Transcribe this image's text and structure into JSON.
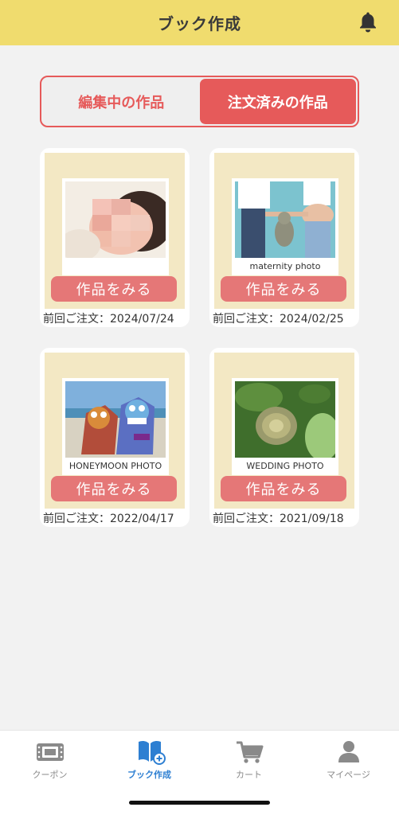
{
  "header": {
    "title": "ブック作成"
  },
  "segment": {
    "tab_editing": "編集中の作品",
    "tab_ordered": "注文済みの作品",
    "active": "ordered"
  },
  "cards": [
    {
      "label": "",
      "button": "作品をみる",
      "date_prefix": "前回ご注文：",
      "date": "2024/07/24",
      "photo": "baby-photo"
    },
    {
      "label": "maternity photo",
      "button": "作品をみる",
      "date_prefix": "前回ご注文：",
      "date": "2024/02/25",
      "photo": "maternity-photo"
    },
    {
      "label": "HONEYMOON PHOTO",
      "button": "作品をみる",
      "date_prefix": "前回ご注文：",
      "date": "2022/04/17",
      "photo": "shisa-photo"
    },
    {
      "label": "WEDDING PHOTO",
      "button": "作品をみる",
      "date_prefix": "前回ご注文：",
      "date": "2021/09/18",
      "photo": "bouquet-photo"
    }
  ],
  "tabbar": {
    "items": [
      {
        "label": "クーポン",
        "icon": "ticket-icon"
      },
      {
        "label": "ブック作成",
        "icon": "book-add-icon"
      },
      {
        "label": "カート",
        "icon": "cart-icon"
      },
      {
        "label": "マイページ",
        "icon": "person-icon"
      }
    ],
    "active": 1
  },
  "colors": {
    "header": "#f0dc6e",
    "accent": "#e65a5a",
    "button": "#e57777",
    "tab_active": "#2d7fd2",
    "card_bg": "#f3e8c4"
  }
}
